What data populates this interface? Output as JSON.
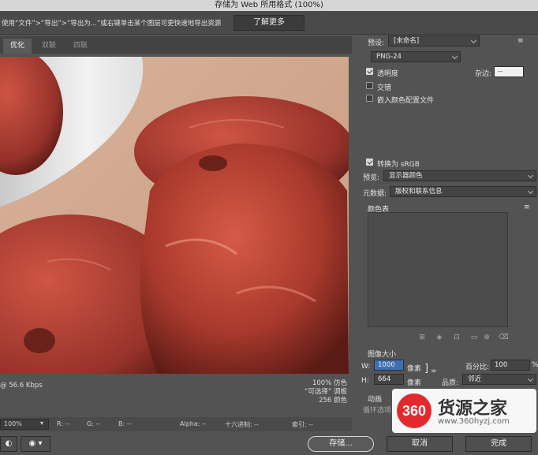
{
  "window": {
    "title": "存储为 Web 所用格式 (100%)"
  },
  "hint": {
    "text": "使用“文件”>“导出”>“导出为...”或右键单击某个图层可更快速地导出资源",
    "learn_more": "了解更多"
  },
  "tabs": [
    {
      "label": "优化",
      "active": true
    },
    {
      "label": "双联",
      "active": false
    },
    {
      "label": "四联",
      "active": false
    }
  ],
  "preview_info": {
    "left": "@ 56.6 Kbps",
    "right_lines": [
      "100% 仿色",
      "“可选择” 调板",
      "256 颜色"
    ]
  },
  "status": {
    "zoom": "100%",
    "r": "R: --",
    "g": "G: --",
    "b": "B: --",
    "alpha": "Alpha: --",
    "hex": "十六进制: --",
    "index": "索引: --"
  },
  "settings": {
    "preset_label": "预设:",
    "preset_value": "[未命名]",
    "format_value": "PNG-24",
    "transparency_label": "透明度",
    "transparency_checked": true,
    "matte_label": "杂边:",
    "matte_value": "--",
    "interlaced_label": "交错",
    "interlaced_checked": false,
    "embed_profile_label": "嵌入颜色配置文件",
    "embed_profile_checked": false,
    "convert_srgb_label": "转换为 sRGB",
    "convert_srgb_checked": true,
    "preview_label": "预览:",
    "preview_value": "显示器颜色",
    "metadata_label": "元数据:",
    "metadata_value": "版权和联系信息",
    "color_table_label": "颜色表"
  },
  "image_size": {
    "section_label": "图像大小",
    "w_label": "W:",
    "w_value": "1000",
    "h_label": "H:",
    "h_value": "664",
    "unit": "像素",
    "percent_label": "百分比:",
    "percent_value": "100",
    "percent_unit": "%",
    "quality_label": "品质:",
    "quality_value": "邻近"
  },
  "animation": {
    "section_label": "动画",
    "loop_label": "循环选项:"
  },
  "buttons": {
    "save": "存储...",
    "cancel": "取消",
    "done": "完成"
  },
  "watermark": {
    "logo": "360",
    "big": "货源之家",
    "small": "www.360hyzj.com"
  },
  "colors": {
    "bg": "#535353",
    "panel": "#444444",
    "accent_select": "#3e6fb3",
    "jujube": "#a8392c"
  }
}
